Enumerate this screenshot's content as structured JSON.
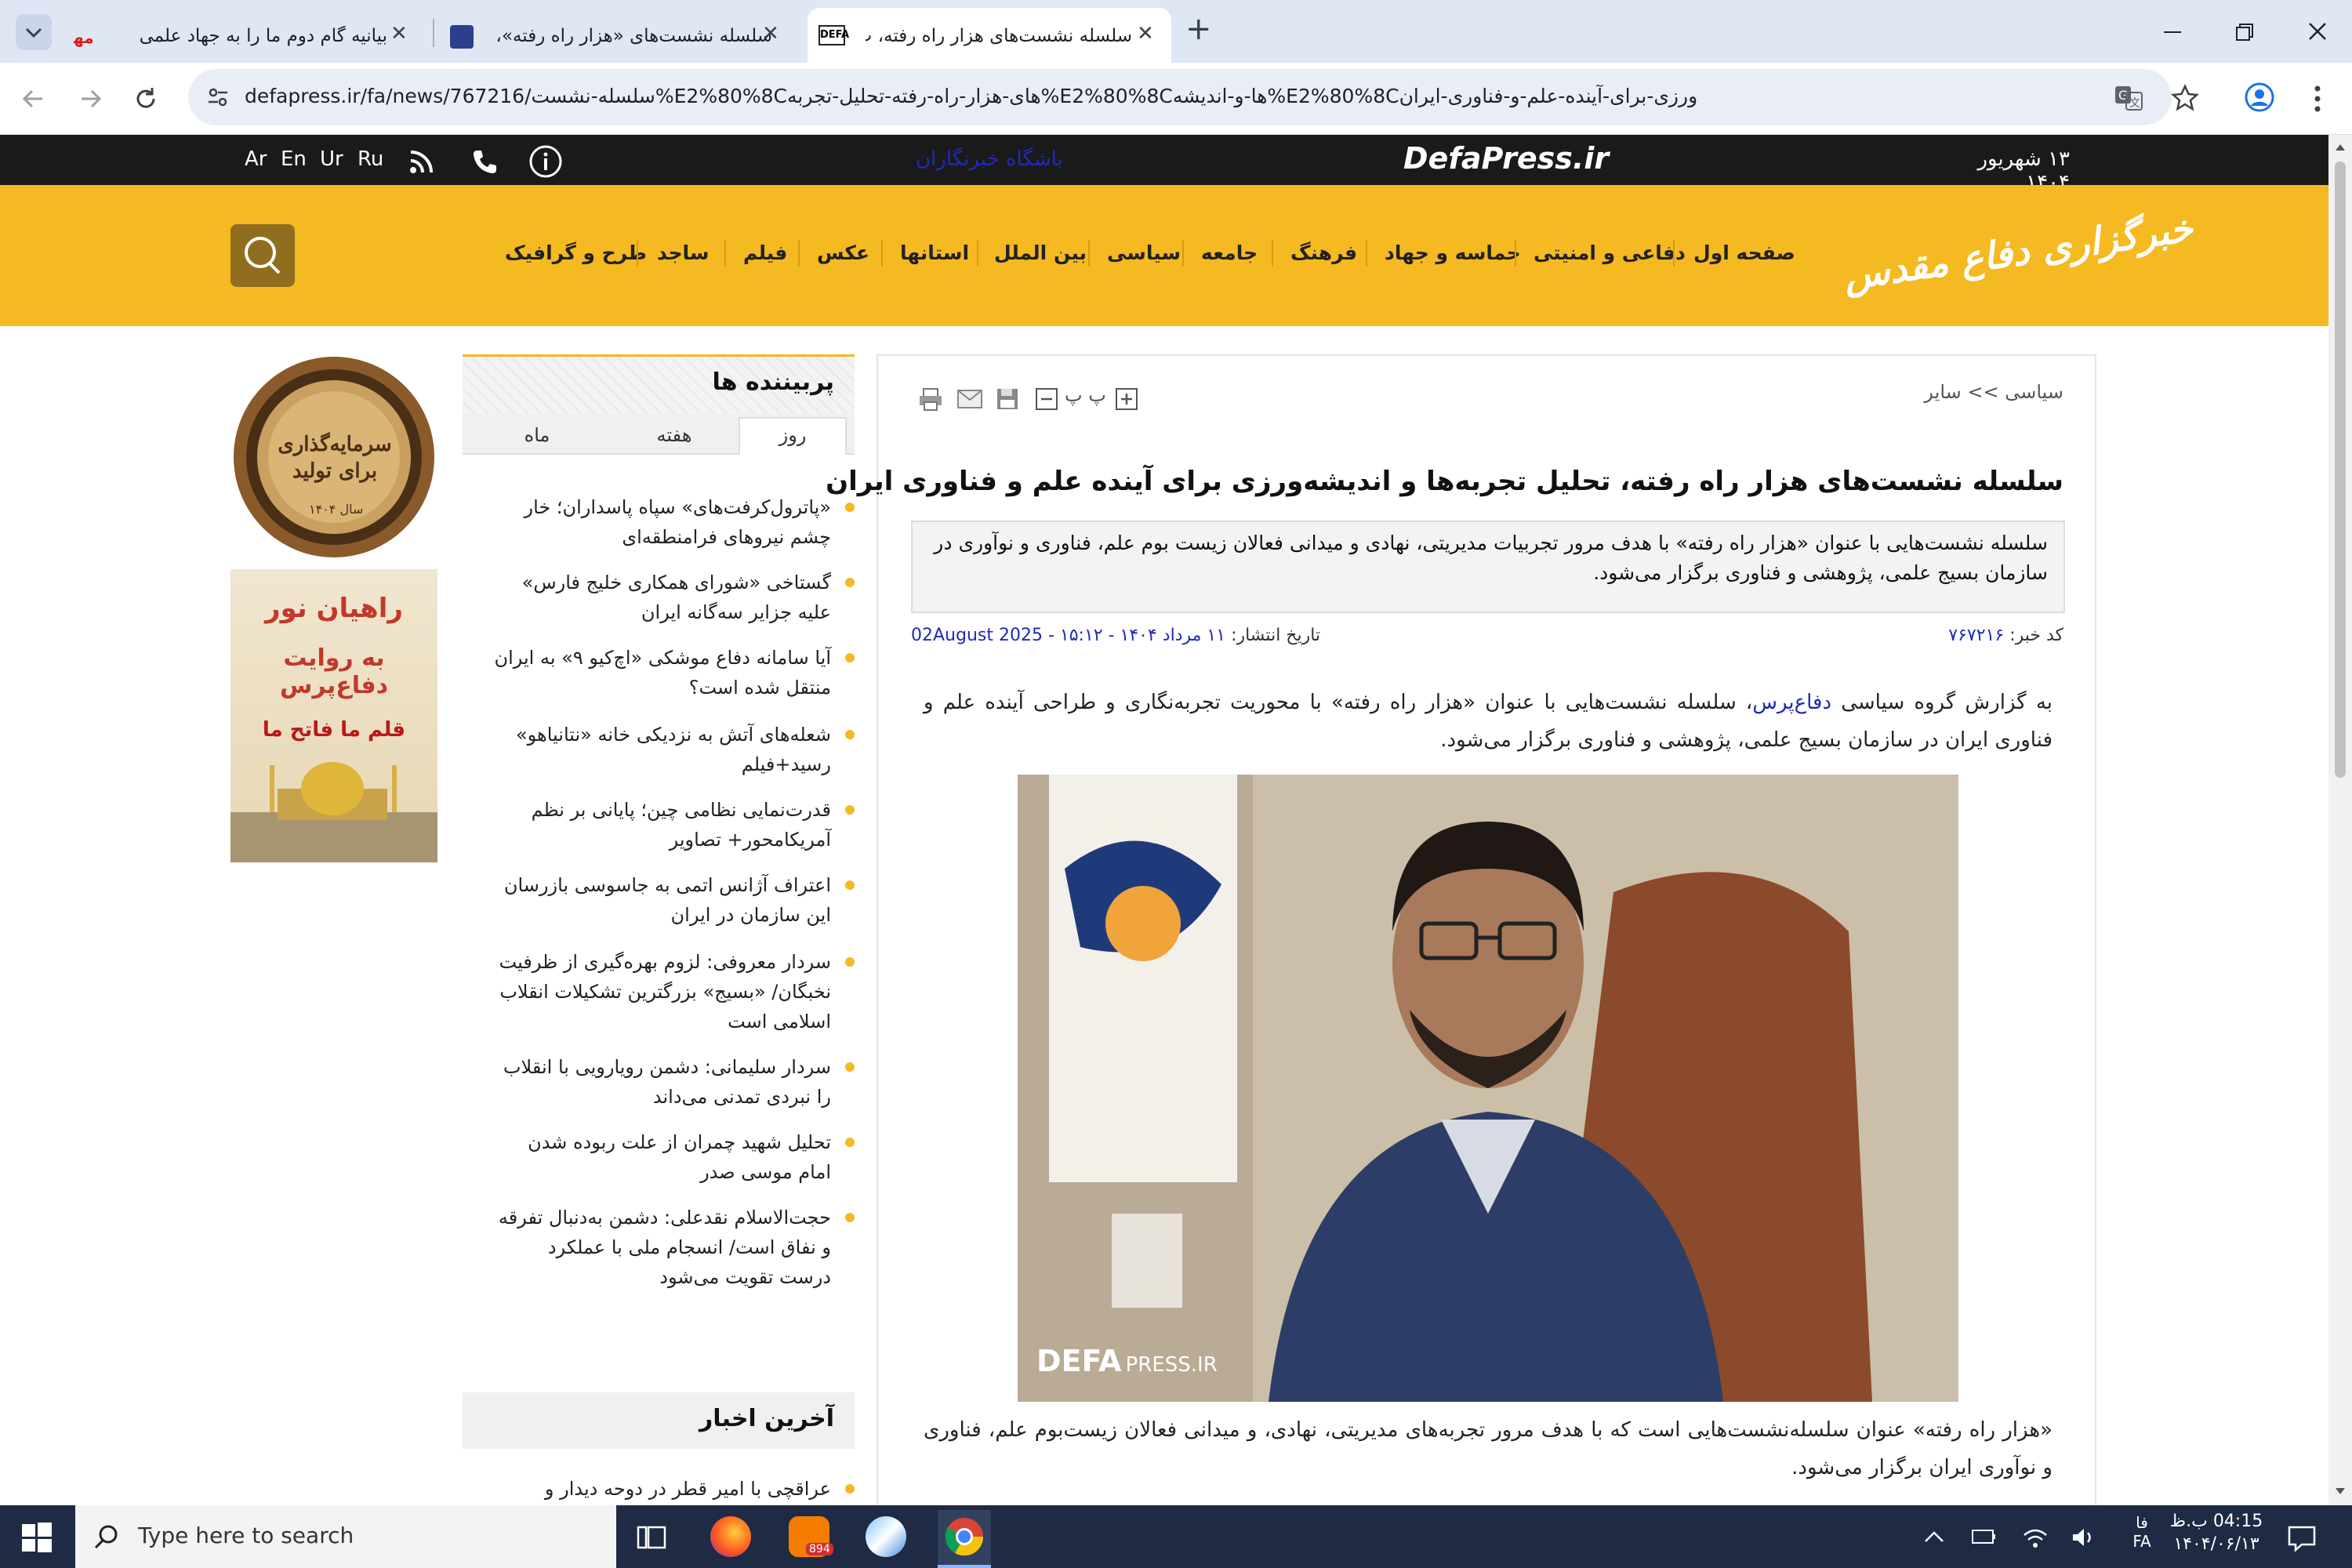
{
  "browser": {
    "tabs": [
      {
        "title": "بیانیه گام دوم ما را به جهاد علمی",
        "active": false
      },
      {
        "title": "سلسله نشست‌های «هزار راه رفته»، ت",
        "active": false
      },
      {
        "title": "سلسله نشست‌های هزار راه رفته، ت",
        "active": true
      }
    ],
    "new_tab": "+",
    "url": "defapress.ir/fa/news/767216/سلسله-نشست%E2%80%8Cهای-هزار-راه-رفته-تحلیل-تجربه%E2%80%8Cها-و-اندیشه%E2%80%8Cورزی-برای-آینده-علم-و-فناوری-ایران"
  },
  "site": {
    "date": "۱۳ شهریور ۱۴۰۴",
    "logo_text": "DefaPress.ir",
    "reporters_club": "باشگاه خبرنگاران",
    "languages": [
      "Ar",
      "En",
      "Ur",
      "Ru"
    ],
    "brand_calligraphy": "خبرگزاری دفاع مقدس",
    "nav": [
      "صفحه اول",
      "دفاعی و امنیتی",
      "حماسه و جهاد",
      "فرهنگ",
      "جامعه",
      "سیاسی",
      "بین الملل",
      "استانها",
      "عکس",
      "فیلم",
      "ساجد",
      "طرح و گرافیک"
    ],
    "accent_color": "#f5b921"
  },
  "article": {
    "breadcrumb": "سیاسی >> سایر",
    "title": "سلسله نشست‌های هزار راه رفته، تحلیل تجربه‌ها و اندیشه‌ورزی برای آینده علم و فناوری ایران",
    "lead": "سلسله نشست‌هایی با عنوان «هزار راه رفته» با هدف مرور تجربیات مدیریتی، نهادی و میدانی فعالان زیست بوم علم، فناوری و نوآوری در سازمان بسیج علمی، پژوهشی و فناوری برگزار می‌شود.",
    "code_label": "کد خبر:",
    "code_value": "۷۶۷۲۱۶",
    "date_label": "تاریخ انتشار:",
    "date_value": "۱۱ مرداد ۱۴۰۴ - ۱۵:۱۲ - 02August 2025",
    "para1_prefix": "به گزارش گروه سیاسی ",
    "para1_link": "دفاع‌پرس",
    "para1_rest": "، سلسله نشست‌هایی با عنوان «هزار راه رفته» با محوریت تجربه‌نگاری و طراحی آینده علم و فناوری ایران در سازمان بسیج علمی، پژوهشی و فناوری برگزار می‌شود.",
    "photo_watermark": "DEFA",
    "photo_watermark2": "PRESS.IR",
    "para2": "«هزار راه رفته» عنوان سلسله‌نشست‌هایی است که با هدف مرور تجربه‌های مدیریتی، نهادی، و میدانی فعالان زیست‌بوم علم، فناوری و نوآوری ایران برگزار می‌شود."
  },
  "sidebar": {
    "popular_title": "پربیننده ها",
    "tabs": [
      "روز",
      "هفته",
      "ماه"
    ],
    "popular": [
      "«پاترول‌کرفت‌های» سپاه پاسداران؛ خار چشم نیروهای فرامنطقه‌ای",
      "گستاخی «شورای همکاری خلیج فارس» علیه جزایر سه‌گانه ایران",
      "آیا سامانه دفاع موشکی «اچ‌کیو ۹» به ایران منتقل شده است؟",
      "شعله‌های آتش به نزدیکی خانه «نتانیاهو» رسید+فیلم",
      "قدرت‌نمایی نظامی چین؛ پایانی بر نظم آمریکامحور+ تصاویر",
      "اعتراف آژانس اتمی به جاسوسی بازرسان این سازمان در ایران",
      "سردار معروفی: لزوم بهره‌گیری از ظرفیت نخبگان/ «بسیج» بزرگترین تشکیلات انقلاب اسلامی است",
      "سردار سلیمانی: دشمن رویارویی با انقلاب را نبردی تمدنی می‌داند",
      "تحلیل شهید چمران از علت ربوده شدن امام موسی صدر",
      "حجت‌الاسلام نقدعلی: دشمن به‌دنبال تفرقه و نفاق است/ انسجام ملی با عملکرد درست تقویت می‌شود"
    ],
    "latest_title": "آخرین اخبار",
    "latest": [
      "عراقچی با امیر قطر در دوحه دیدار و"
    ],
    "ad1_text": "سرمایه‌گذاری برای تولید",
    "ad1_sub": "سال ۱۴۰۴",
    "ad2_line1": "راهیان نور",
    "ad2_line2": "به روایت دفاع‌پرس",
    "ad2_line3": "قلم ما فاتح ما"
  },
  "taskbar": {
    "search_placeholder": "Type here to search",
    "badge": "894",
    "lang": "فا",
    "lang2": "FA",
    "time": "04:15 ب.ظ",
    "date": "۱۴۰۴/۰۶/۱۳"
  }
}
